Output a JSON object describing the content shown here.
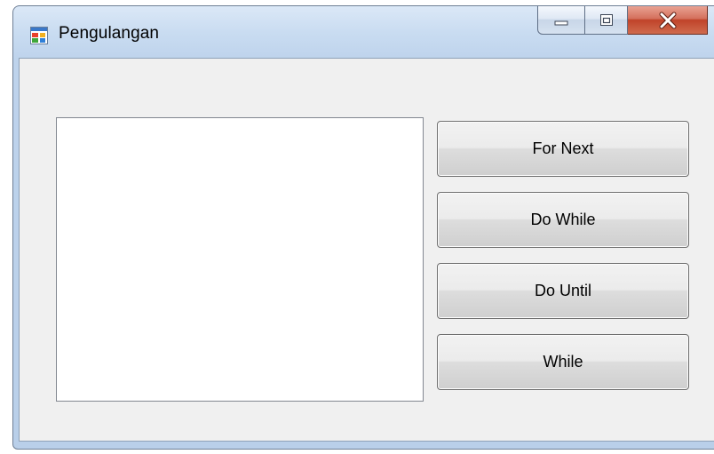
{
  "window": {
    "title": "Pengulangan",
    "icon": "windows-form-icon"
  },
  "caption_buttons": {
    "minimize_icon": "minimize-icon",
    "maximize_icon": "maximize-icon",
    "close_icon": "close-icon"
  },
  "listbox": {
    "items": []
  },
  "buttons": {
    "for_next": "For Next",
    "do_while": "Do While",
    "do_until": "Do Until",
    "while": "While"
  },
  "colors": {
    "close_button": "#c0432a",
    "client_background": "#f0f0f0",
    "title_bar": "#c9dcf1"
  }
}
